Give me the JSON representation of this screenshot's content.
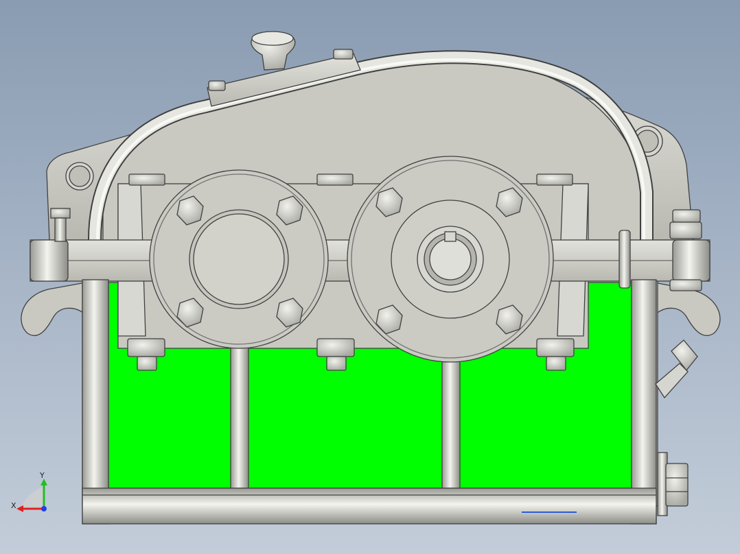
{
  "viewport": {
    "background_top": "#8a9cb2",
    "background_bottom": "#c3cdd9"
  },
  "model": {
    "body_color": "#c8c8c0",
    "section_color": "#00ff00",
    "edge_color": "#404040"
  },
  "triad": {
    "x_label": "X",
    "y_label": "Y",
    "x_color": "#e02020",
    "y_color": "#20c020",
    "z_color": "#2040e0"
  },
  "scale_bar": {
    "color": "#2a5bd7"
  }
}
